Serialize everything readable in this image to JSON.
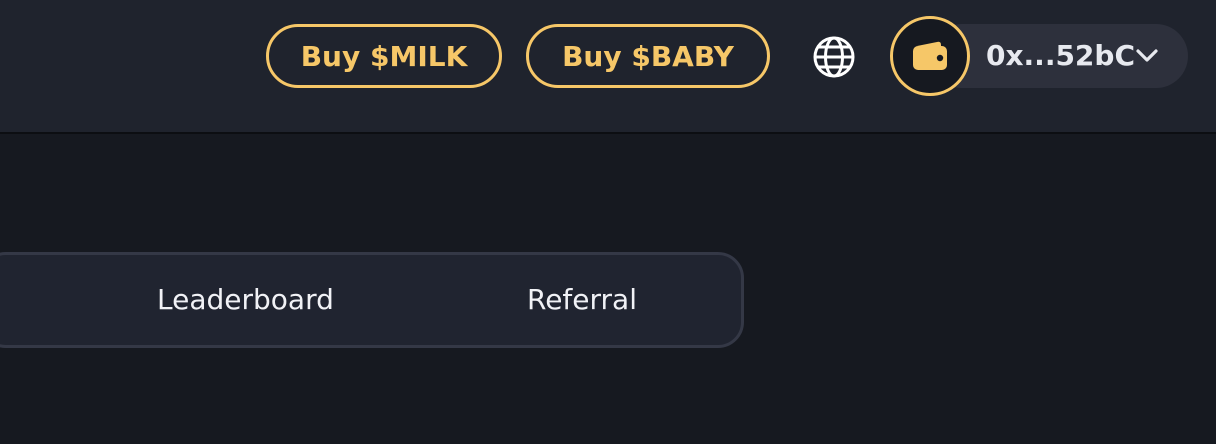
{
  "header": {
    "buy_milk_label": "Buy $MILK",
    "buy_baby_label": "Buy $BABY",
    "language_icon": "globe-icon",
    "wallet": {
      "icon": "wallet-icon",
      "address": "0x...52bC",
      "dropdown_icon": "chevron-down-icon"
    }
  },
  "nav": {
    "tabs": [
      {
        "label": "Leaderboard"
      },
      {
        "label": "Referral"
      }
    ]
  },
  "colors": {
    "accent": "#f6c768",
    "header_bg": "#1f232d",
    "page_bg": "#161920",
    "pill_bg": "#2d303c",
    "text": "#f1f2f6"
  }
}
